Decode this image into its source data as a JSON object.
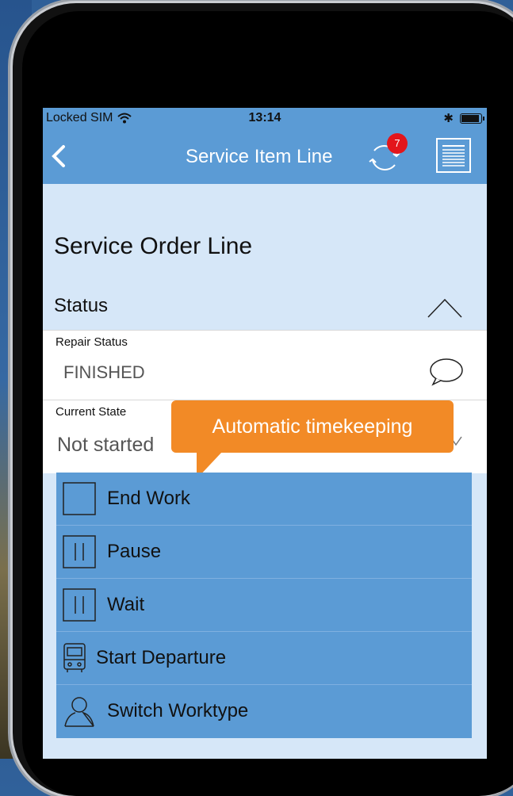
{
  "status_bar": {
    "carrier": "Locked SIM",
    "time": "13:14"
  },
  "navbar": {
    "title": "Service Item Line",
    "sync_badge_count": "7"
  },
  "page": {
    "section_title": "Service Order Line"
  },
  "status_section": {
    "label": "Status"
  },
  "repair_status": {
    "label": "Repair Status",
    "value": "FINISHED"
  },
  "current_state": {
    "label": "Current State",
    "value": "Not started"
  },
  "tooltip": {
    "text": "Automatic timekeeping"
  },
  "actions": [
    {
      "label": "End Work",
      "icon": "square-icon"
    },
    {
      "label": "Pause",
      "icon": "pause-icon"
    },
    {
      "label": "Wait",
      "icon": "pause-icon"
    },
    {
      "label": "Start Departure",
      "icon": "bus-icon"
    },
    {
      "label": "Switch Worktype",
      "icon": "person-icon"
    }
  ],
  "colors": {
    "accent": "#5b9bd5",
    "tooltip": "#f28a26",
    "badge": "#e3161b",
    "screen_bg": "#d6e7f8"
  }
}
